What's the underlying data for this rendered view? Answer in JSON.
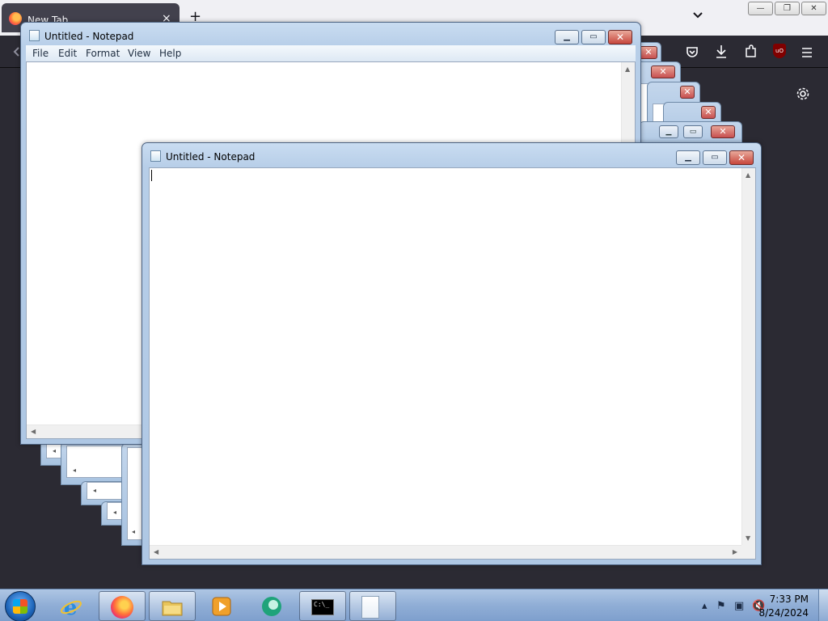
{
  "browser": {
    "tab_title": "New Tab",
    "tab_close": "×",
    "new_tab": "+",
    "list_tabs": "⌄",
    "ublock_label": "uO",
    "controls": {
      "minimize": "—",
      "restore": "❐",
      "close": "✕"
    }
  },
  "notepad_back": {
    "title": "Untitled - Notepad",
    "menu": [
      "File",
      "Edit",
      "Format",
      "View",
      "Help"
    ],
    "content": ""
  },
  "notepad_front": {
    "title": "Untitled - Notepad",
    "content": ""
  },
  "window_controls": {
    "minimize": "▁",
    "maximize": "▭",
    "close": "✕"
  },
  "taskbar": {
    "apps": [
      {
        "name": "Internet Explorer",
        "icon": "ie-icon"
      },
      {
        "name": "Firefox",
        "icon": "firefox-icon",
        "active": true
      },
      {
        "name": "File Explorer",
        "icon": "folder-icon",
        "active": true
      },
      {
        "name": "Media Player",
        "icon": "media-player-icon"
      },
      {
        "name": "Messenger",
        "icon": "messenger-icon"
      },
      {
        "name": "Command Prompt",
        "icon": "cmd-icon",
        "active": true,
        "label": "C:\\_"
      },
      {
        "name": "Notepad",
        "icon": "notepad-icon",
        "active": true
      }
    ],
    "clock_time": "7:33 PM",
    "clock_date": "8/24/2024"
  },
  "colors": {
    "firefox_dark": "#2b2a33",
    "taskbar": "#90aed6",
    "close_red": "#c7463c"
  }
}
